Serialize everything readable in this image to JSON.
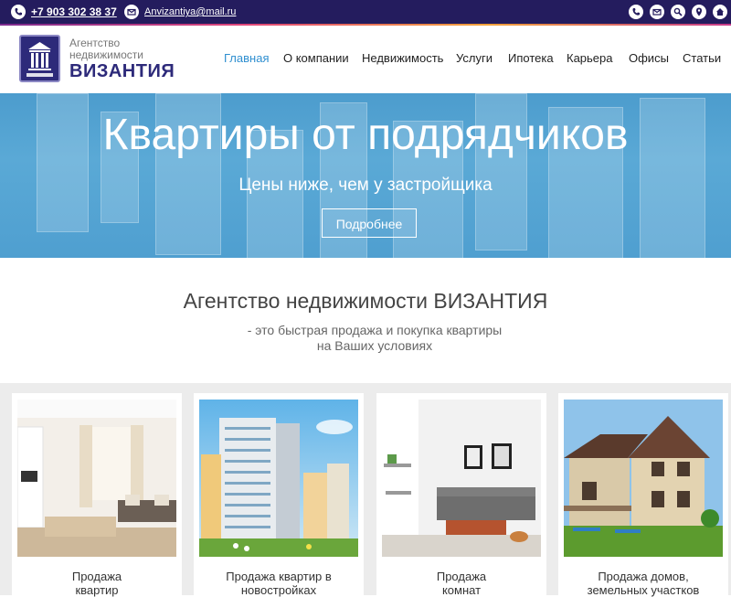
{
  "topbar": {
    "phone": "+7 903 302 38 37",
    "email": "Anvizantiya@mail.ru",
    "icons": [
      "phone-icon",
      "mail-icon",
      "search-icon",
      "map-icon",
      "home-icon"
    ]
  },
  "logo": {
    "line1": "Агентство",
    "line2": "недвижимости",
    "line3": "ВИЗАНТИЯ"
  },
  "nav": {
    "items": [
      "Главная",
      "О компании",
      "Недвижимость",
      "Услуги",
      "Ипотека",
      "Карьера",
      "Офисы",
      "Статьи"
    ],
    "active": "Главная"
  },
  "hero": {
    "title": "Квартиры от подрядчиков",
    "subtitle": "Цены ниже, чем у застройщика",
    "button": "Подробнее"
  },
  "intro": {
    "title": "Агентство недвижимости ВИЗАНТИЯ",
    "line1": "- это быстрая продажа и покупка квартиры",
    "line2": "на Ваших условиях"
  },
  "cards": [
    {
      "line1": "Продажа",
      "line2": "квартир"
    },
    {
      "line1": "Продажа квартир в",
      "line2": "новостройках"
    },
    {
      "line1": "Продажа",
      "line2": "комнат"
    },
    {
      "line1": "Продажа домов,",
      "line2": "земельных участков"
    }
  ],
  "colors": {
    "topbar": "#241c5e",
    "brand": "#2d2a7a",
    "nav_active": "#2f8fd0",
    "hero": "#4f9fd0"
  }
}
